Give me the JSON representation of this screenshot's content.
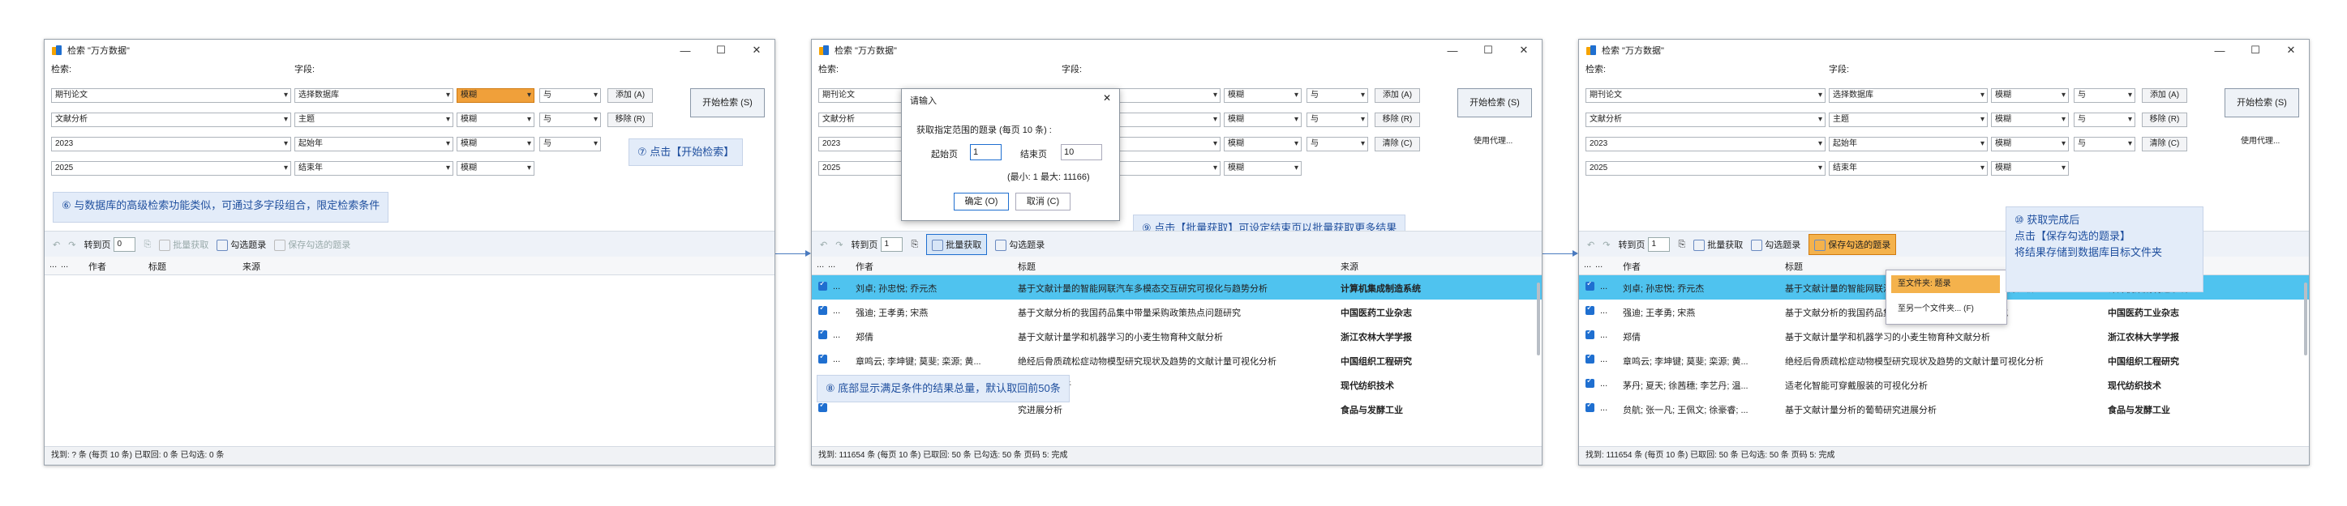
{
  "window": {
    "title": "检索 \"万方数据\"",
    "minimize": "—",
    "maximize": "☐",
    "close": "✕"
  },
  "search": {
    "search_label": "检索:",
    "field_label": "字段:",
    "rows": [
      {
        "term": "期刊论文",
        "field": "选择数据库",
        "match": "模糊",
        "logic": "与",
        "action": "添加 (A)"
      },
      {
        "term": "文献分析",
        "field": "主题",
        "match": "模糊",
        "logic": "与",
        "action": "移除 (R)"
      },
      {
        "term": "2023",
        "field": "起始年",
        "match": "模糊",
        "logic": "与",
        "action": "清除 (C)"
      },
      {
        "term": "2025",
        "field": "结束年",
        "match": "模糊"
      }
    ],
    "start_button": "开始检索 (S)",
    "use_proxy": "使用代理..."
  },
  "toolbar": {
    "goto_page": "转到页",
    "page_value_empty": "0",
    "page_value": "1",
    "batch_fetch": "批量获取",
    "check_records": "勾选题录",
    "save_checked": "保存勾选的题录"
  },
  "grid": {
    "col_dots1": "...",
    "col_dots2": "...",
    "col_author": "作者",
    "col_title": "标题",
    "col_source": "来源",
    "rows": [
      {
        "dots": "...",
        "author": "刘卓; 孙忠悦; 乔元杰",
        "title": "基于文献计量的智能网联汽车多模态交互研究可视化与趋势分析",
        "source": "计算机集成制造系统"
      },
      {
        "dots": "...",
        "author": "强迪; 王孝勇; 宋燕",
        "title": "基于文献分析的我国药品集中带量采购政策热点问题研究",
        "source": "中国医药工业杂志"
      },
      {
        "dots": "...",
        "author": "郑倩",
        "title": "基于文献计量学和机器学习的小麦生物育种文献分析",
        "source": "浙江农林大学学报"
      },
      {
        "dots": "...",
        "author": "章鸣云; 李坤键; 莫斐; 栾源; 黄...",
        "title": "绝经后骨质疏松症动物模型研究现状及趋势的文献计量可视化分析",
        "source": "中国组织工程研究"
      },
      {
        "dots": "...",
        "author": "茅丹; 夏天; 徐茜穗; 李艺丹; 温...",
        "title": "适老化智能可穿戴服装的可视化分析",
        "source": "现代纺织技术"
      },
      {
        "dots": "...",
        "author": "贠航; 张一凡; 王佩文; 徐豪睿; ...",
        "title": "基于文献计量分析的葡萄研究进展分析",
        "source": "食品与发酵工业"
      }
    ],
    "w2_title_partial": [
      "绝经后骨质疏松症动物模型研究现状及趋势的文献计量可视化分析",
      "的可视化分析",
      "究进展分析"
    ]
  },
  "status": {
    "initial": "找到: ? 条 (每页 10 条)   已取回: 0 条   已勾选: 0 条",
    "after": "找到: 111654 条 (每页 10 条)   已取回: 50 条   已勾选: 50 条   页码 5: 完成"
  },
  "dialog": {
    "title": "请输入",
    "prompt": "获取指定范围的题录 (每页 10 条) :",
    "start_label": "起始页",
    "start_value": "1",
    "end_label": "结束页",
    "end_value": "10",
    "range_hint": "(最小: 1 最大: 11166)",
    "ok": "确定 (O)",
    "cancel": "取消 (C)"
  },
  "save_menu": {
    "to_folder": "至文件夹: 题录",
    "to_other": "至另一个文件夹... (F)"
  },
  "callouts": {
    "c6": "⑥ 与数据库的高级检索功能类似，可通过多字段组合，限定检索条件",
    "c7": "⑦ 点击【开始检索】",
    "c8": "⑧ 底部显示满足条件的结果总量，默认取回前50条",
    "c9": "⑨ 点击【批量获取】可设定结束页以批量获取更多结果",
    "c10_line1": "⑩ 获取完成后",
    "c10_line2": "点击【保存勾选的题录】",
    "c10_line3": "将结果存储到数据库目标文件夹"
  },
  "colors": {
    "accent": "#1f6fd0",
    "highlight_row": "#4fc3ef",
    "callout_bg": "#e3ecf9",
    "field_highlight": "#f0a03a"
  }
}
